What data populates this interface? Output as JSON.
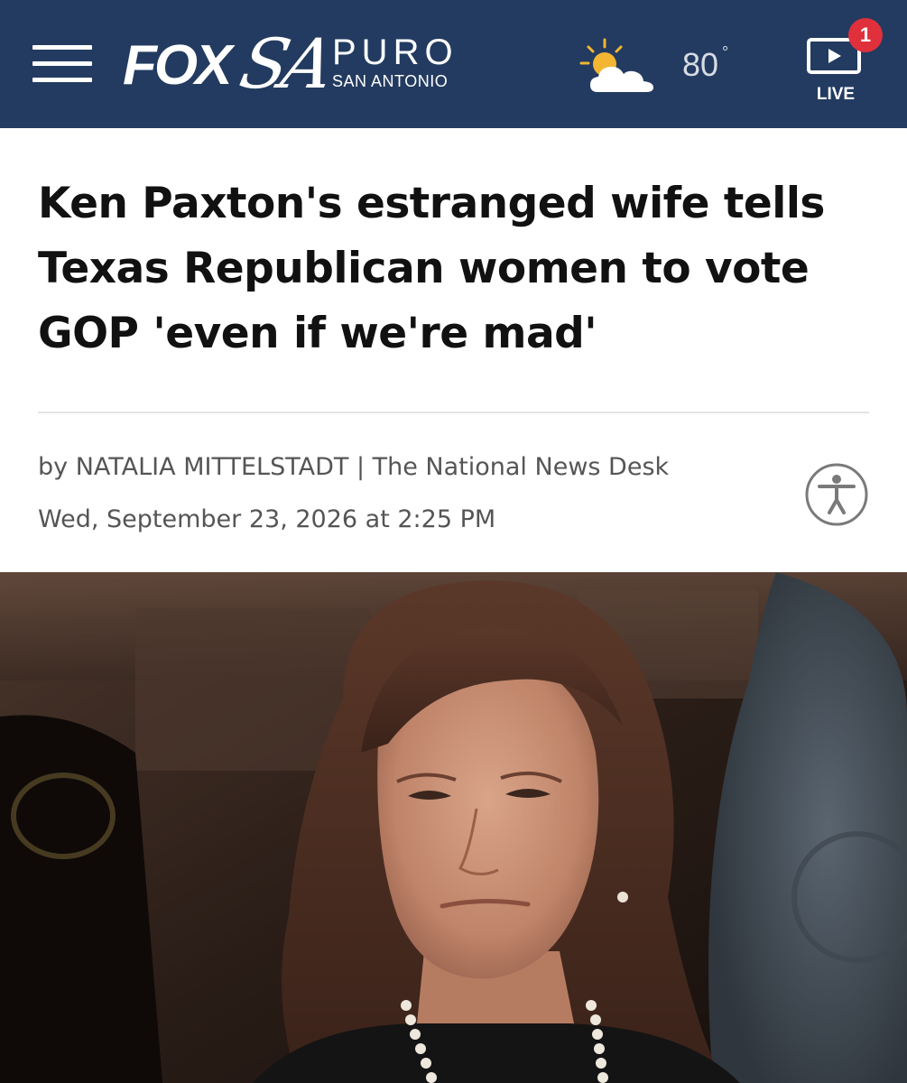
{
  "header": {
    "menu_icon": "hamburger-menu-icon",
    "logo": {
      "fox": "FOX",
      "sa": "SA",
      "puro": "PURO",
      "city": "SAN ANTONIO"
    },
    "weather": {
      "icon": "partly-sunny-icon",
      "temperature": "80",
      "degree": "°"
    },
    "live": {
      "icon": "play-video-icon",
      "label": "LIVE",
      "badge_count": "1"
    }
  },
  "article": {
    "headline": "Ken Paxton's estranged wife tells Texas Republican women to vote GOP 'even if we're mad'",
    "byline": "by NATALIA MITTELSTADT | The National News Desk",
    "date": "Wed, September 23, 2026 at 2:25 PM",
    "accessibility_icon": "accessibility-icon",
    "photo": "news photo of a woman with shoulder-length brown hair wearing a pearl necklace"
  },
  "colors": {
    "header_bg": "#233b60",
    "badge_red": "#e0303b",
    "headline_text": "#111111",
    "meta_text": "#555555"
  }
}
